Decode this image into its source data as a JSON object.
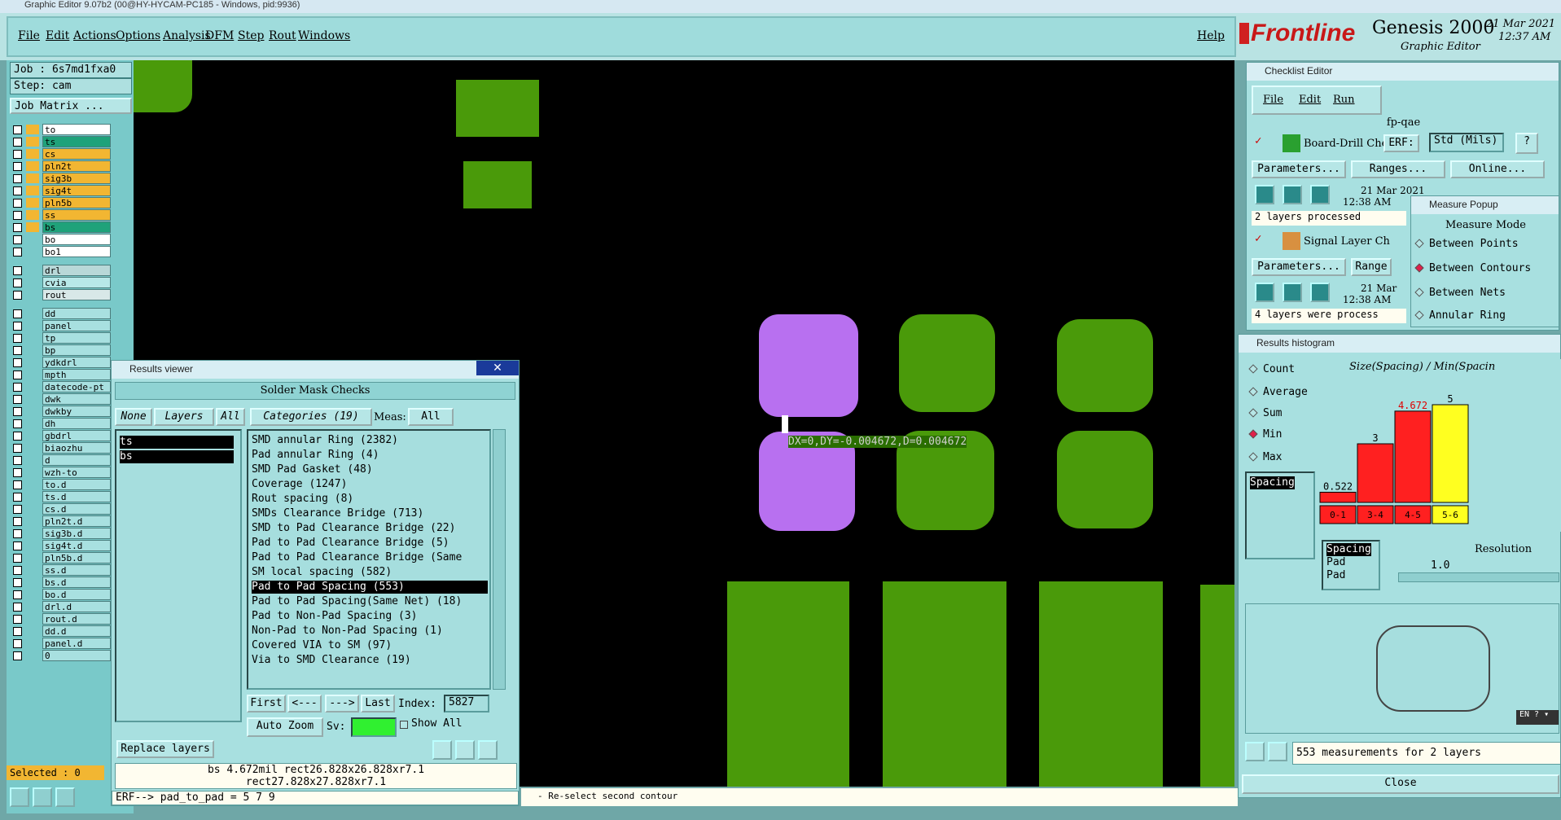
{
  "window_title": "Graphic Editor 9.07b2 (00@HY-HYCAM-PC185 - Windows, pid:9936)",
  "menu": {
    "file": "File",
    "edit": "Edit",
    "actions": "Actions",
    "options": "Options",
    "analysis": "Analysis",
    "dfm": "DFM",
    "step": "Step",
    "rout": "Rout",
    "windows": "Windows",
    "help": "Help"
  },
  "brand": {
    "logo": "Frontline",
    "product": "Genesis 2000",
    "subtitle": "Graphic Editor",
    "date": "21 Mar 2021",
    "time": "12:37 AM"
  },
  "job": {
    "job_label": "Job : 6s7md1fxa0",
    "step_label": "Step: cam",
    "matrix_button": "Job Matrix ...",
    "selected": "Selected : 0"
  },
  "layers": [
    {
      "name": "to",
      "color": "#ffffff"
    },
    {
      "name": "ts",
      "color": "#1fa27a"
    },
    {
      "name": "cs",
      "color": "#f2b632"
    },
    {
      "name": "pln2t",
      "color": "#f2b632"
    },
    {
      "name": "sig3b",
      "color": "#f2b632"
    },
    {
      "name": "sig4t",
      "color": "#f2b632"
    },
    {
      "name": "pln5b",
      "color": "#f2b632"
    },
    {
      "name": "ss",
      "color": "#f2b632"
    },
    {
      "name": "bs",
      "color": "#1fa27a"
    },
    {
      "name": "bo",
      "color": "#ffffff"
    },
    {
      "name": "bo1",
      "color": "#ffffff"
    },
    {
      "name": "drl",
      "color": "#b8d8d8"
    },
    {
      "name": "cvia",
      "color": "#b8e8e8"
    },
    {
      "name": "rout",
      "color": "#d8e8e8"
    },
    {
      "name": "dd",
      "color": "#a8e0e0"
    },
    {
      "name": "panel",
      "color": "#a8e0e0"
    },
    {
      "name": "tp",
      "color": "#a8e0e0"
    },
    {
      "name": "bp",
      "color": "#a8e0e0"
    },
    {
      "name": "ydkdrl",
      "color": "#a8e0e0"
    },
    {
      "name": "mpth",
      "color": "#a8e0e0"
    },
    {
      "name": "datecode-pt",
      "color": "#a8e0e0"
    },
    {
      "name": "dwk",
      "color": "#a8e0e0"
    },
    {
      "name": "dwkby",
      "color": "#a8e0e0"
    },
    {
      "name": "dh",
      "color": "#a8e0e0"
    },
    {
      "name": "gbdrl",
      "color": "#a8e0e0"
    },
    {
      "name": "biaozhu",
      "color": "#a8e0e0"
    },
    {
      "name": "d",
      "color": "#a8e0e0"
    },
    {
      "name": "wzh-to",
      "color": "#a8e0e0"
    },
    {
      "name": "to.d",
      "color": "#a8e0e0"
    },
    {
      "name": "ts.d",
      "color": "#a8e0e0"
    },
    {
      "name": "cs.d",
      "color": "#a8e0e0"
    },
    {
      "name": "pln2t.d",
      "color": "#a8e0e0"
    },
    {
      "name": "sig3b.d",
      "color": "#a8e0e0"
    },
    {
      "name": "sig4t.d",
      "color": "#a8e0e0"
    },
    {
      "name": "pln5b.d",
      "color": "#a8e0e0"
    },
    {
      "name": "ss.d",
      "color": "#a8e0e0"
    },
    {
      "name": "bs.d",
      "color": "#a8e0e0"
    },
    {
      "name": "bo.d",
      "color": "#a8e0e0"
    },
    {
      "name": "drl.d",
      "color": "#a8e0e0"
    },
    {
      "name": "rout.d",
      "color": "#a8e0e0"
    },
    {
      "name": "dd.d",
      "color": "#a8e0e0"
    },
    {
      "name": "panel.d",
      "color": "#a8e0e0"
    },
    {
      "name": "0",
      "color": "#a8e0e0"
    }
  ],
  "canvas": {
    "measure_text": "DX=0,DY=-0.004672,D=0.004672"
  },
  "status_bar": "- Re-select second contour",
  "results_viewer": {
    "title": "Results viewer",
    "header": "Solder Mask Checks",
    "none": "None",
    "layers": "Layers",
    "all": "All",
    "categories": "Categories (19)",
    "meas_label": "Meas:",
    "meas_value": "All",
    "layer_items": [
      "ts",
      "bs"
    ],
    "category_items": [
      "SMD annular Ring (2382)",
      "Pad annular Ring (4)",
      "SMD Pad Gasket (48)",
      "Coverage (1247)",
      "Rout spacing (8)",
      "SMDs Clearance Bridge (713)",
      "SMD to Pad Clearance Bridge (22)",
      "Pad to Pad Clearance Bridge (5)",
      "Pad to Pad Clearance Bridge (Same",
      "SM local spacing (582)",
      "Pad to Pad Spacing (553)",
      "Pad to Pad Spacing(Same Net) (18)",
      "Pad to Non-Pad Spacing (3)",
      "Non-Pad to Non-Pad Spacing (1)",
      "Covered VIA to SM (97)",
      "Via to SMD Clearance (19)"
    ],
    "selected_category": "Pad to Pad Spacing (553)",
    "first": "First",
    "prev": "<---",
    "next": "--->",
    "last": "Last",
    "index_label": "Index:",
    "index_value": "5827",
    "auto_zoom": "Auto Zoom",
    "sv_label": "Sv:",
    "show_all": "Show All",
    "replace_layers": "Replace layers",
    "info_line1": "bs 4.672mil  rect26.828x26.828xr7.1",
    "info_line2": "rect27.828x27.828xr7.1",
    "erf_line": "ERF--> pad_to_pad = 5 7 9"
  },
  "checklist_editor": {
    "title": "Checklist Editor",
    "file": "File",
    "edit": "Edit",
    "run": "Run",
    "name": "fp-qae",
    "check1": "Board-Drill Che",
    "erf": "ERF:",
    "erf_value": "Std (Mils)",
    "parameters": "Parameters...",
    "ranges": "Ranges...",
    "online": "Online...",
    "date": "21 Mar 2021",
    "time": "12:38 AM",
    "status1": "2 layers processed",
    "check2": "Signal Layer Ch",
    "ranges2": "Range",
    "date2": "21 Mar",
    "time2": "12:38 AM",
    "status2": "4 layers were process"
  },
  "measure_popup": {
    "title": "Measure Popup",
    "mode": "Measure Mode",
    "options": [
      "Between Points",
      "Between Contours",
      "Between Nets",
      "Annular Ring"
    ],
    "selected": "Between Contours"
  },
  "histogram": {
    "title": "Results histogram",
    "modes": [
      "Count",
      "Average",
      "Sum",
      "Min",
      "Max"
    ],
    "selected_mode": "Min",
    "chart_title": "Size(Spacing) / Min(Spacin",
    "list_item": "Spacing",
    "list2": [
      "Spacing",
      "Pad",
      "Pad"
    ],
    "resolution_label": "Resolution",
    "resolution_value": "1.0",
    "footer": "553 measurements for 2 layers",
    "close": "Close"
  },
  "chart_data": {
    "type": "bar",
    "categories": [
      "0-1",
      "3-4",
      "4-5",
      "5-6"
    ],
    "series": [
      {
        "values": [
          0.522,
          3,
          4.672,
          5
        ]
      }
    ],
    "data_labels": [
      "0.522",
      "3",
      "4.672",
      "5"
    ],
    "colors": [
      "#ff2020",
      "#ff2020",
      "#ff2020",
      "#ffff20"
    ],
    "title": "Size(Spacing) / Min(Spacin"
  }
}
